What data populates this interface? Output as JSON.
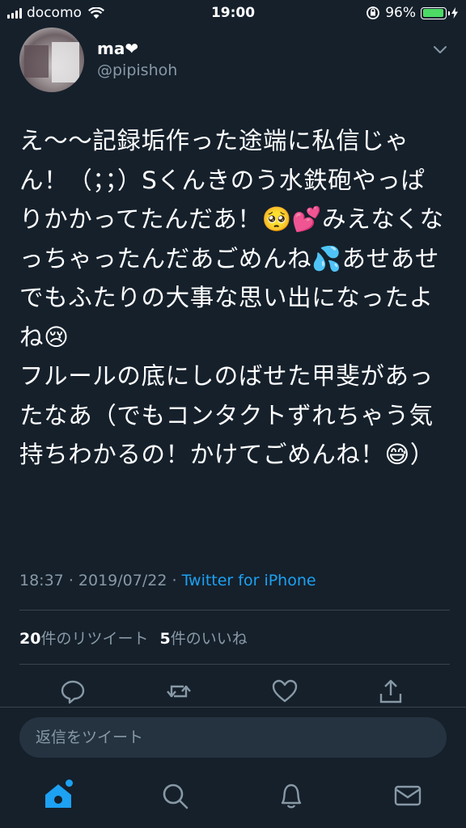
{
  "status_bar": {
    "carrier": "docomo",
    "time": "19:00",
    "battery": "96%",
    "battery_level": 0.96,
    "icons": [
      "signal-icon",
      "wifi-icon",
      "rotation-lock-icon",
      "battery-icon",
      "charging-icon"
    ]
  },
  "author": {
    "display_name": "ma❤",
    "handle": "@pipishoh"
  },
  "tweet": {
    "text": "え〜〜記録垢作った途端に私信じゃん！（；；）Sくんきのう水鉄砲やっぱりかかってたんだあ！🥺💕みえなくなっちゃったんだあごめんね💦あせあせ\nでもふたりの大事な思い出になったよね😢\nフルールの底にしのばせた甲斐があったなあ（でもコンタクトずれちゃう気持ちわかるの！かけてごめんね！😅）",
    "time": "18:37",
    "separator": "·",
    "date": "2019/07/22",
    "source": "Twitter for iPhone"
  },
  "stats": {
    "retweet_count": "20",
    "retweet_label": "件のリツイート",
    "like_count": "5",
    "like_label": "件のいいね"
  },
  "actions": [
    "reply-icon",
    "retweet-icon",
    "like-icon",
    "share-icon"
  ],
  "reply": {
    "placeholder": "返信をツイート"
  },
  "tabs": [
    "home-icon",
    "search-icon",
    "notifications-icon",
    "messages-icon"
  ],
  "colors": {
    "background": "#15202b",
    "accent": "#1da1f2",
    "secondary_text": "#8899a6",
    "divider": "#38444d",
    "battery": "#4cd964"
  }
}
